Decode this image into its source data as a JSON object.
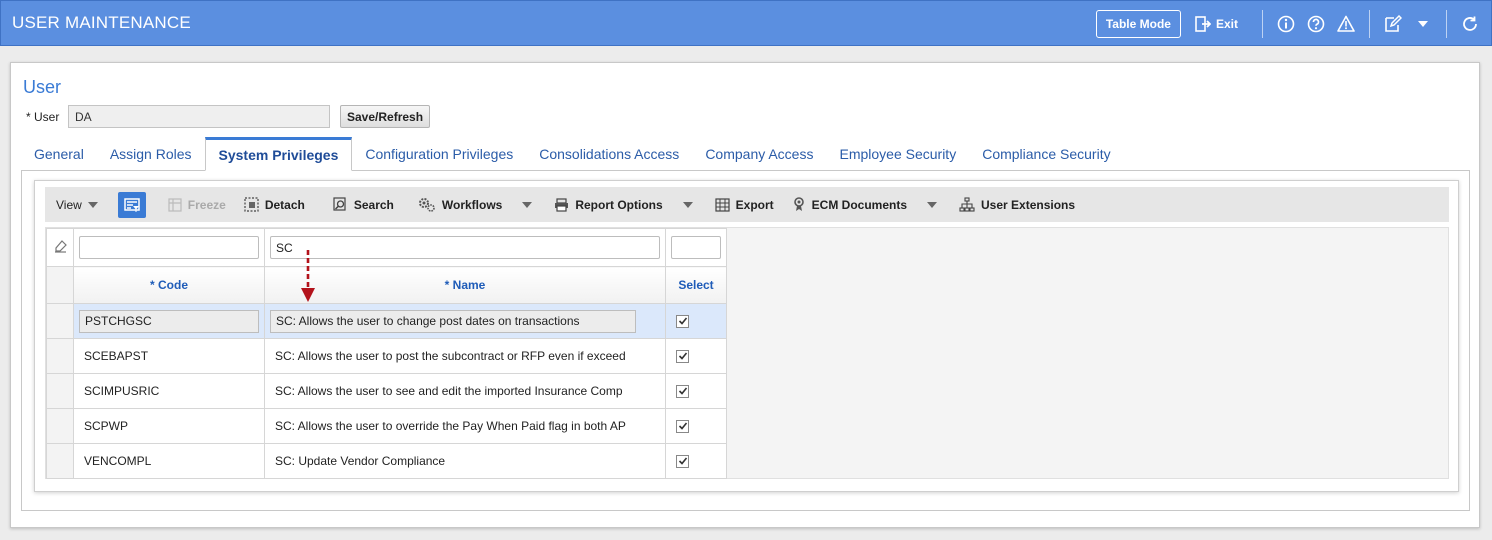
{
  "app": {
    "title": "USER MAINTENANCE",
    "table_mode_label": "Table Mode",
    "exit_label": "Exit"
  },
  "header_icons": [
    "exit-icon",
    "info-icon",
    "help-icon",
    "warning-icon",
    "edit-icon",
    "chevron-down-icon",
    "refresh-icon"
  ],
  "section": {
    "title": "User"
  },
  "user_field": {
    "label": "* User",
    "value": "DA"
  },
  "save_refresh_label": "Save/Refresh",
  "tabs": [
    {
      "label": "General",
      "active": false
    },
    {
      "label": "Assign Roles",
      "active": false
    },
    {
      "label": "System Privileges",
      "active": true
    },
    {
      "label": "Configuration Privileges",
      "active": false
    },
    {
      "label": "Consolidations Access",
      "active": false
    },
    {
      "label": "Company Access",
      "active": false
    },
    {
      "label": "Employee Security",
      "active": false
    },
    {
      "label": "Compliance Security",
      "active": false
    }
  ],
  "toolbar": {
    "view": "View",
    "freeze": "Freeze",
    "detach": "Detach",
    "search": "Search",
    "workflows": "Workflows",
    "report_options": "Report Options",
    "export": "Export",
    "ecm_documents": "ECM Documents",
    "user_extensions": "User Extensions"
  },
  "filters": {
    "code": "",
    "name": "SC",
    "select": ""
  },
  "columns": {
    "code": "* Code",
    "name": "* Name",
    "select": "Select"
  },
  "rows": [
    {
      "code": "PSTCHGSC",
      "name": "SC: Allows the user to change post dates on transactions",
      "select": true,
      "selected": true
    },
    {
      "code": "SCEBAPST",
      "name": "SC: Allows the user to post the subcontract or RFP even if exceed",
      "select": true,
      "selected": false
    },
    {
      "code": "SCIMPUSRIC",
      "name": "SC: Allows the user to see and edit the imported Insurance Comp",
      "select": true,
      "selected": false
    },
    {
      "code": "SCPWP",
      "name": "SC: Allows the user to override the Pay When Paid flag in both AP",
      "select": true,
      "selected": false
    },
    {
      "code": "VENCOMPL",
      "name": "SC: Update Vendor Compliance",
      "select": true,
      "selected": false
    }
  ],
  "colors": {
    "header_bg": "#5b8fe0",
    "accent": "#3a7bd5",
    "arrow": "#b3121b"
  }
}
